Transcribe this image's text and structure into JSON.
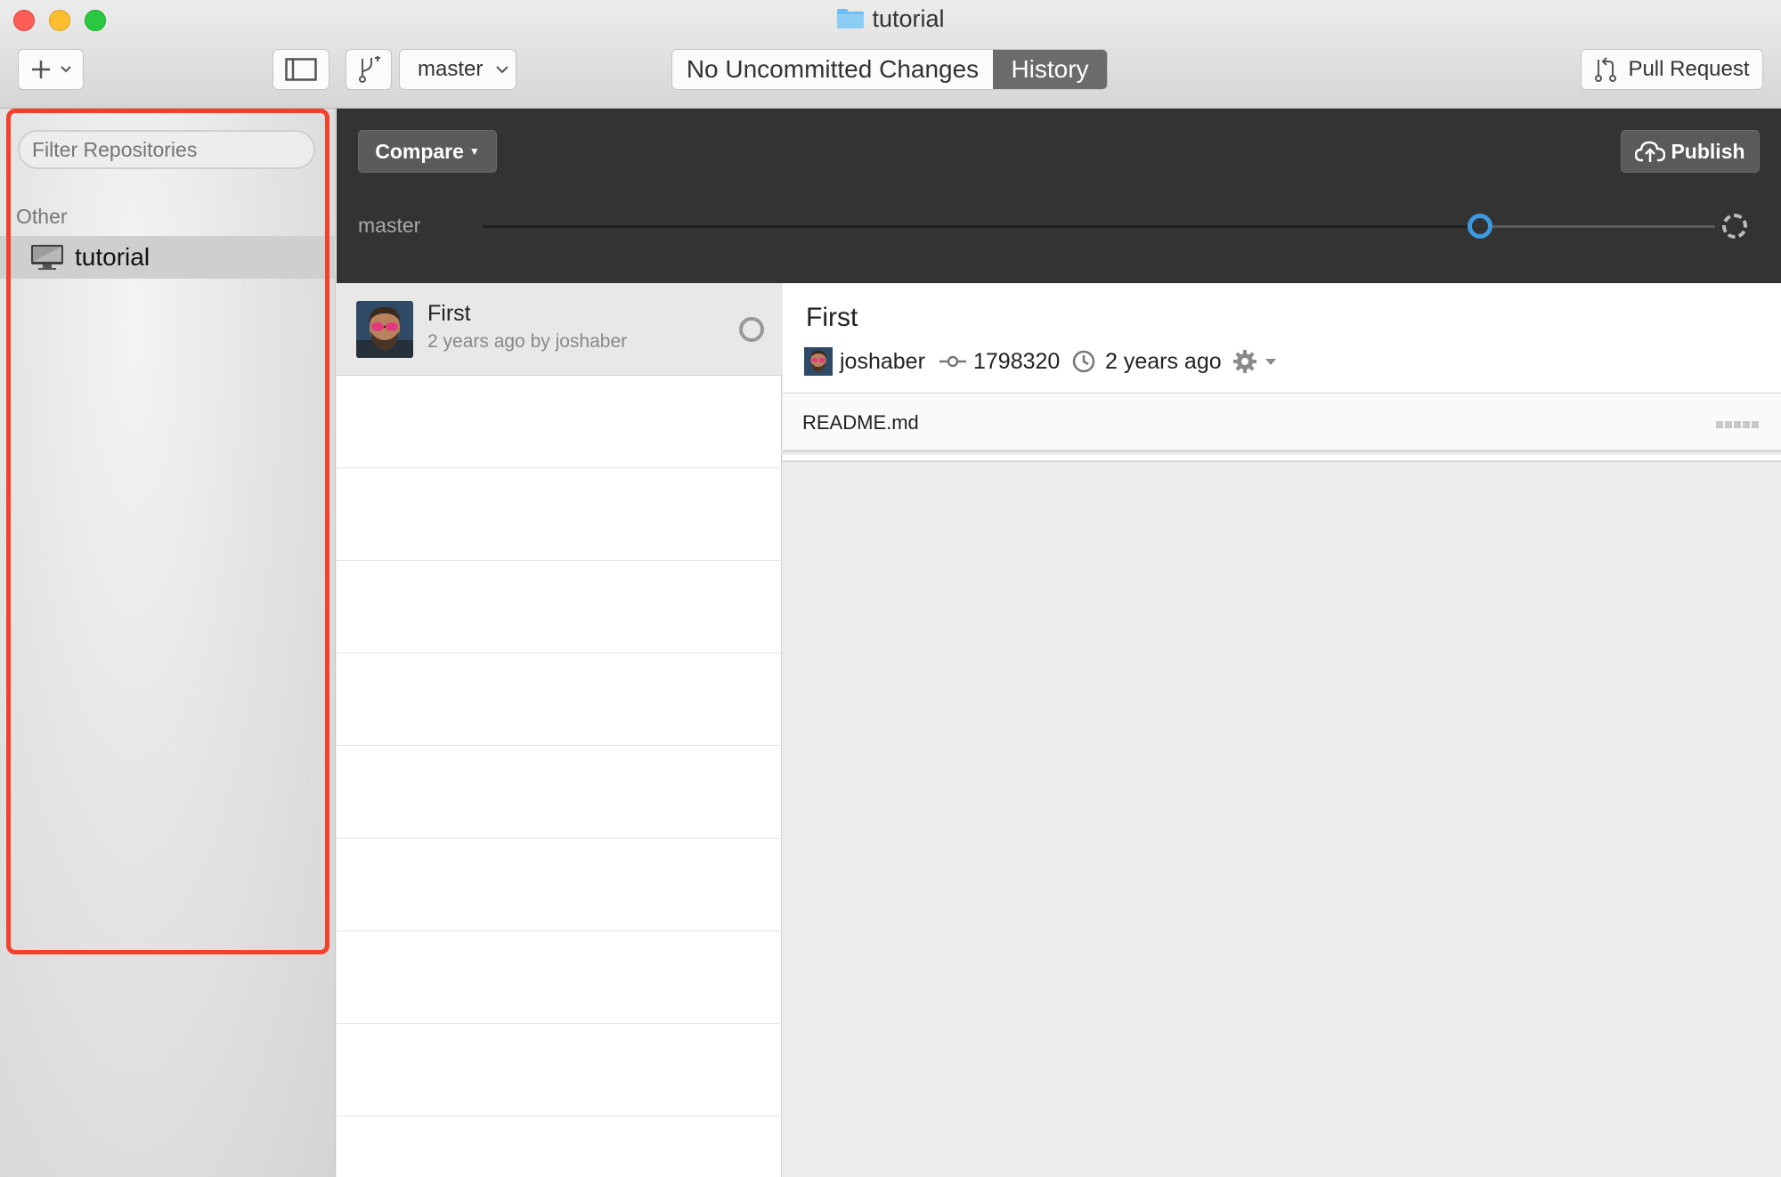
{
  "window": {
    "title": "tutorial"
  },
  "toolbar": {
    "add_label": "+",
    "branch_name": "master",
    "seg_changes": "No Uncommitted Changes",
    "seg_history": "History",
    "pull_request": "Pull Request"
  },
  "sidebar": {
    "filter_placeholder": "Filter Repositories",
    "group": "Other",
    "repos": [
      {
        "name": "tutorial"
      }
    ]
  },
  "header": {
    "compare": "Compare",
    "publish": "Publish",
    "branch_label": "master"
  },
  "commits": [
    {
      "title": "First",
      "subtitle": "2 years ago by joshaber"
    }
  ],
  "detail": {
    "title": "First",
    "author": "joshaber",
    "sha": "1798320",
    "time": "2 years ago",
    "files": [
      {
        "name": "README.md"
      }
    ]
  },
  "colors": {
    "accent": "#3b99e0",
    "highlight": "#f4412c",
    "dark_header": "#333333",
    "segment_on": "#6b6b6b"
  }
}
